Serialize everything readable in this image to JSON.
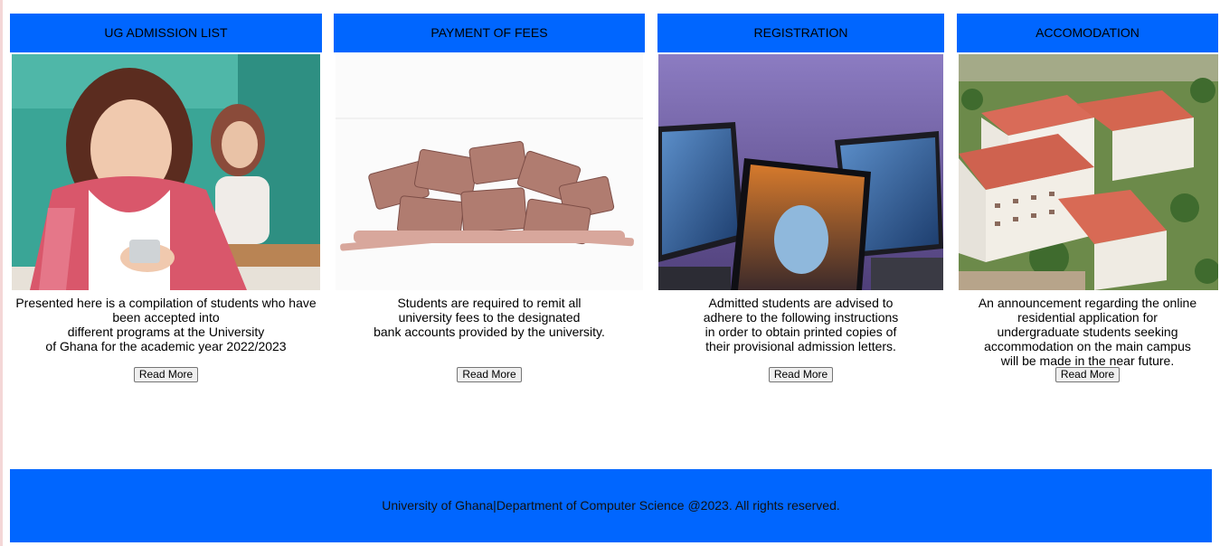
{
  "cards": [
    {
      "title": "UG ADMISSION LIST",
      "text": "Presented here is a compilation of students who have been accepted into\ndifferent programs at the University\nof Ghana for the academic year 2022/2023",
      "button": "Read More",
      "image": "student-with-phone-photo"
    },
    {
      "title": "PAYMENT OF FEES",
      "text": "Students are required to remit all\nuniversity fees to the designated\nbank accounts provided by the university.",
      "button": "Read More",
      "image": "cedi-banknotes-pile-photo"
    },
    {
      "title": "REGISTRATION",
      "text": "Admitted students are advised to\nadhere to the following instructions\nin order to obtain printed copies of\ntheir provisional admission letters.",
      "button": "Read More",
      "image": "laptops-photo"
    },
    {
      "title": "ACCOMODATION",
      "text": "An announcement regarding the online\nresidential application for\nundergraduate students seeking\naccommodation on the main campus\nwill be made in the near future.",
      "button": "Read More",
      "image": "campus-hostels-aerial-photo"
    }
  ],
  "footer": {
    "text": "University of Ghana|Department of Computer Science @2023. All rights reserved."
  },
  "colors": {
    "primary": "#0066ff"
  }
}
